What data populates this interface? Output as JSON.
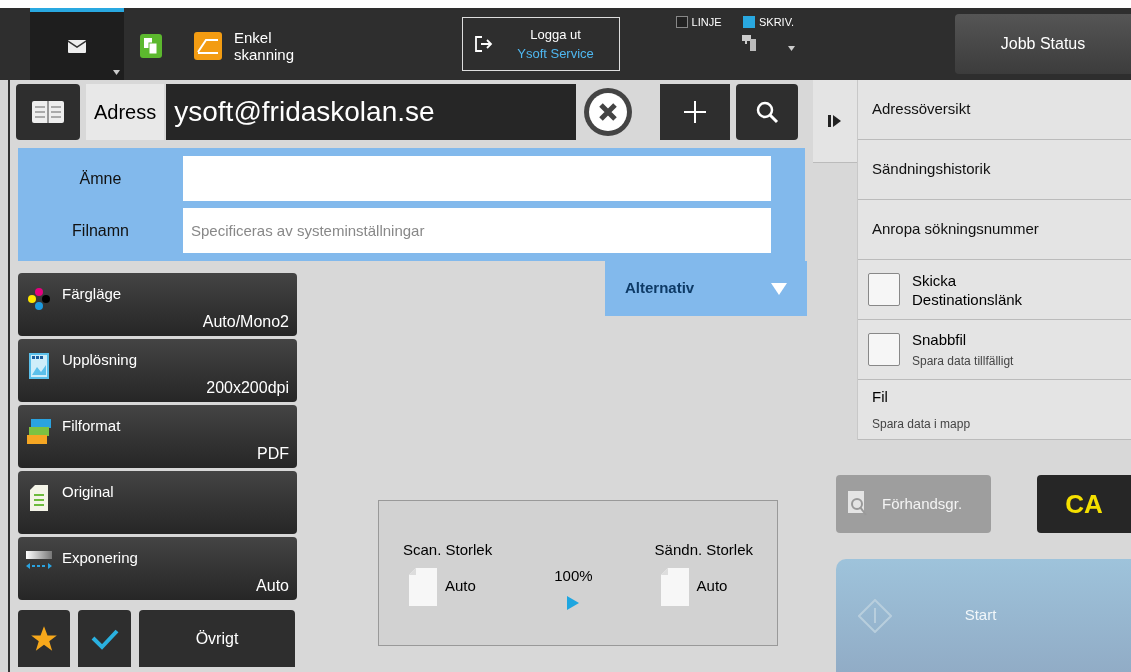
{
  "top_bar": {
    "tabs": [
      {
        "kind": "mail",
        "selected": true
      },
      {
        "kind": "copy",
        "selected": false
      },
      {
        "kind": "scan",
        "label": "Enkel\nskanning",
        "selected": false
      }
    ],
    "logout": {
      "label": "Logga ut",
      "user": "Ysoft Service"
    },
    "indicators": [
      {
        "label": "LINJE",
        "checked": false
      },
      {
        "label": "SKRIV.",
        "checked": true
      }
    ],
    "job_status": "Jobb Status"
  },
  "address": {
    "label": "Adress",
    "value": "ysoft@fridaskolan.se"
  },
  "fields": [
    {
      "label": "Ämne"
    },
    {
      "label": "Filnamn",
      "placeholder": "Specificeras av systeminställningar"
    }
  ],
  "options_tab": {
    "label": "Alternativ"
  },
  "settings": [
    {
      "kind": "color",
      "label": "Färgläge",
      "value": "Auto/Mono2"
    },
    {
      "kind": "resolution",
      "label": "Upplösning",
      "value": "200x200dpi"
    },
    {
      "kind": "format",
      "label": "Filformat",
      "value": "PDF"
    },
    {
      "kind": "original",
      "label": "Original"
    },
    {
      "kind": "exposure",
      "label": "Exponering",
      "value": "Auto"
    }
  ],
  "other_button": "Övrigt",
  "size_box": {
    "scan_label": "Scan. Storlek",
    "scan_value": "Auto",
    "ratio": "100%",
    "send_label": "Sändn. Storlek",
    "send_value": "Auto"
  },
  "side_menu": [
    {
      "kind": "link",
      "label": "Adressöversikt"
    },
    {
      "kind": "link",
      "label": "Sändningshistorik"
    },
    {
      "kind": "link",
      "label": "Anropa sökningsnummer"
    },
    {
      "kind": "check",
      "label": "Skicka\nDestinationslänk",
      "checked": false
    },
    {
      "kind": "check",
      "label": "Snabbfil",
      "sub": "Spara data tillfälligt",
      "checked": false
    },
    {
      "kind": "info",
      "label": "Fil",
      "sub": "Spara data i mapp"
    }
  ],
  "preview": {
    "label": "Förhandsgr.",
    "disabled": true
  },
  "clear_all": "CA",
  "start": {
    "label": "Start",
    "disabled": true
  }
}
